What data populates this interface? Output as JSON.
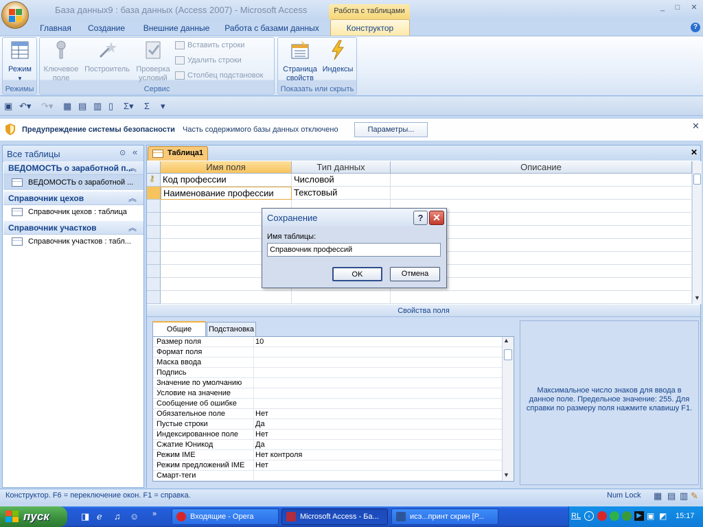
{
  "window": {
    "title": "База данных9 : база данных (Access 2007) - Microsoft Access",
    "context_tab_title": "Работа с таблицами",
    "minimize": "_",
    "maximize": "□",
    "close": "✕"
  },
  "ribbon_tabs": [
    "Главная",
    "Создание",
    "Внешние данные",
    "Работа с базами данных",
    "Конструктор"
  ],
  "ribbon": {
    "groups": {
      "rezhimy": {
        "label": "Режимы",
        "rezhim_btn": "Режим"
      },
      "servis": {
        "label": "Сервис",
        "key_btn_1": "Ключевое",
        "key_btn_2": "поле",
        "builder_btn": "Построитель",
        "check_btn_1": "Проверка",
        "check_btn_2": "условий",
        "insert_rows": "Вставить строки",
        "delete_rows": "Удалить строки",
        "lookup_col": "Столбец  подстановок"
      },
      "show": {
        "label": "Показать или скрыть",
        "prop_sheet_1": "Страница",
        "prop_sheet_2": "свойств",
        "indexes": "Индексы"
      }
    }
  },
  "security": {
    "title": "Предупреждение системы безопасности",
    "text": "Часть содержимого базы данных отключено",
    "button": "Параметры..."
  },
  "nav": {
    "header": "Все таблицы",
    "groups": [
      {
        "label": "ВЕДОМОСТЬ о заработной п...",
        "items": [
          "ВЕДОМОСТЬ о заработной ..."
        ]
      },
      {
        "label": "Справочник цехов",
        "items": [
          "Справочник цехов : таблица"
        ]
      },
      {
        "label": "Справочник участков",
        "items": [
          "Справочник участков : табл..."
        ]
      }
    ]
  },
  "doc_tab": "Таблица1",
  "grid": {
    "headers": [
      "Имя поля",
      "Тип данных",
      "Описание"
    ],
    "rows": [
      {
        "name": "Код профессии",
        "type": "Числовой",
        "desc": ""
      },
      {
        "name": "Наименование профессии",
        "type": "Текстовый",
        "desc": ""
      }
    ]
  },
  "props": {
    "bar_title": "Свойства поля",
    "tabs": [
      "Общие",
      "Подстановка"
    ],
    "rows": [
      {
        "n": "Размер поля",
        "v": "10"
      },
      {
        "n": "Формат поля",
        "v": ""
      },
      {
        "n": "Маска ввода",
        "v": ""
      },
      {
        "n": "Подпись",
        "v": ""
      },
      {
        "n": "Значение по умолчанию",
        "v": ""
      },
      {
        "n": "Условие на значение",
        "v": ""
      },
      {
        "n": "Сообщение об ошибке",
        "v": ""
      },
      {
        "n": "Обязательное поле",
        "v": "Нет"
      },
      {
        "n": "Пустые строки",
        "v": "Да"
      },
      {
        "n": "Индексированное поле",
        "v": "Нет"
      },
      {
        "n": "Сжатие Юникод",
        "v": "Да"
      },
      {
        "n": "Режим IME",
        "v": "Нет контроля"
      },
      {
        "n": "Режим предложений IME",
        "v": "Нет"
      },
      {
        "n": "Смарт-теги",
        "v": ""
      }
    ],
    "hint": "Максимальное число знаков для ввода в данное поле.  Предельное значение: 255. Для справки по размеру поля нажмите клавишу F1."
  },
  "dialog": {
    "title": "Сохранение",
    "help": "?",
    "close": "✕",
    "label": "Имя таблицы:",
    "value": "Справочник профессий",
    "ok": "OK",
    "cancel": "Отмена"
  },
  "status": {
    "text": "Конструктор.  F6 = переключение окон.  F1 = справка.",
    "numlock": "Num Lock"
  },
  "taskbar": {
    "start": "пуск",
    "items": [
      "Входящие - Opera",
      "Microsoft Access - Ба...",
      "исэ...принт скрин [Р..."
    ],
    "lang": "RL",
    "clock": "15:17"
  }
}
